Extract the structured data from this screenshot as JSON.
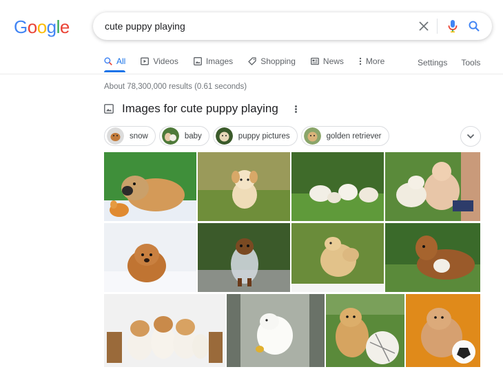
{
  "logo": {
    "text": "Google",
    "letters": [
      "G",
      "o",
      "o",
      "g",
      "l",
      "e"
    ],
    "colors": [
      "#4285F4",
      "#EA4335",
      "#FBBC05",
      "#4285F4",
      "#34A853",
      "#EA4335"
    ]
  },
  "search": {
    "query": "cute puppy playing",
    "clear_icon": "close-icon",
    "voice_icon": "mic-icon",
    "search_icon": "search-icon"
  },
  "tabs": [
    {
      "label": "All",
      "icon": "search-icon",
      "active": true
    },
    {
      "label": "Videos",
      "icon": "video-icon"
    },
    {
      "label": "Images",
      "icon": "image-icon"
    },
    {
      "label": "Shopping",
      "icon": "tag-icon"
    },
    {
      "label": "News",
      "icon": "newspaper-icon"
    },
    {
      "label": "More",
      "icon": "more-vert-icon"
    }
  ],
  "tools": {
    "settings": "Settings",
    "tools": "Tools"
  },
  "result_stats": "About 78,300,000 results (0.61 seconds)",
  "images_section": {
    "title": "Images for cute puppy playing",
    "chips": [
      {
        "label": "snow"
      },
      {
        "label": "baby"
      },
      {
        "label": "puppy pictures"
      },
      {
        "label": "golden retriever"
      }
    ]
  },
  "colors": {
    "accent": "#1a73e8",
    "text": "#202124",
    "muted": "#70757a",
    "tab_text": "#5f6368"
  }
}
